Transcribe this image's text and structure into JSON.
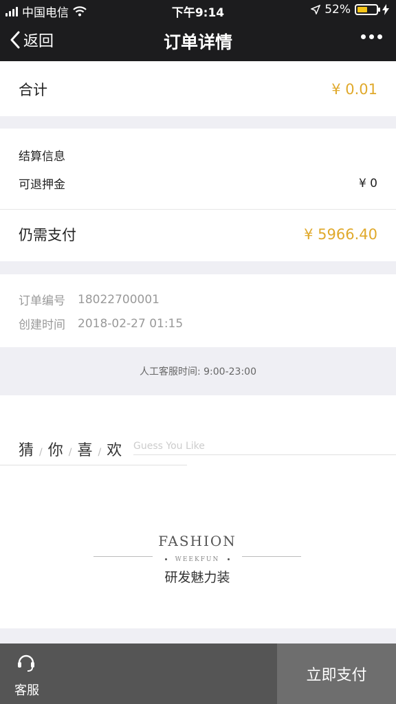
{
  "status_bar": {
    "carrier": "中国电信",
    "time": "下午9:14",
    "battery_percent": "52%",
    "battery_level": 0.52,
    "signal_bars": 4
  },
  "nav": {
    "back_label": "返回",
    "title": "订单详情"
  },
  "total": {
    "label": "合计",
    "value": "¥ 0.01"
  },
  "settlement": {
    "heading": "结算信息",
    "deposit_label": "可退押金",
    "deposit_value": "¥ 0",
    "due_label": "仍需支付",
    "due_value": "¥ 5966.40"
  },
  "order": {
    "number_label": "订单编号",
    "number_value": "18022700001",
    "created_label": "创建时间",
    "created_value": "2018-02-27 01:15"
  },
  "service_hours": "人工客服时间: 9:00-23:00",
  "guess": {
    "chars": [
      "猜",
      "你",
      "喜",
      "欢"
    ],
    "separator": "/",
    "english": "Guess You Like"
  },
  "brand": {
    "wordmark": "FASHION",
    "sub": "WEEKFUN",
    "caption": "研发魅力装"
  },
  "bottom": {
    "service_label": "客服",
    "pay_label": "立即支付"
  },
  "colors": {
    "accent": "#e0a92b",
    "nav_bg": "#1c1c1e",
    "bottom_left_bg": "#555555",
    "bottom_right_bg": "#6e6e6e"
  }
}
